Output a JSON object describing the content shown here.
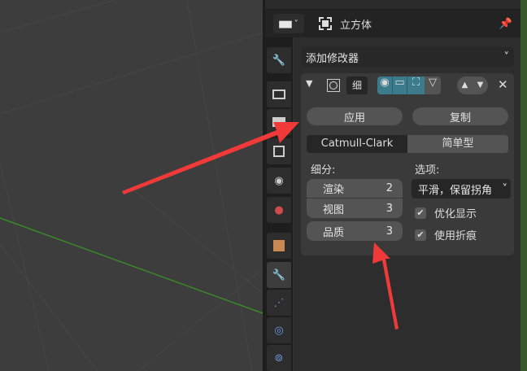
{
  "header": {
    "object_name": "立方体"
  },
  "add_modifier": "添加修改器",
  "modifier": {
    "name": "细",
    "apply": "应用",
    "copy": "复制",
    "type_options": [
      "Catmull-Clark",
      "简单型"
    ],
    "selected_type": "Catmull-Clark",
    "subdivision_label": "细分:",
    "render_label": "渲染",
    "render_value": "2",
    "viewport_label": "视图",
    "viewport_value": "3",
    "quality_label": "品质",
    "quality_value": "3",
    "options_label": "选项:",
    "uv_smooth": "平滑，保留拐角",
    "optimal_display": "优化显示",
    "use_creases": "使用折痕"
  },
  "colors": {
    "accent": "#3c7b8b",
    "arrow": "#f03a3a",
    "axis_x": "#3b8a2a"
  }
}
